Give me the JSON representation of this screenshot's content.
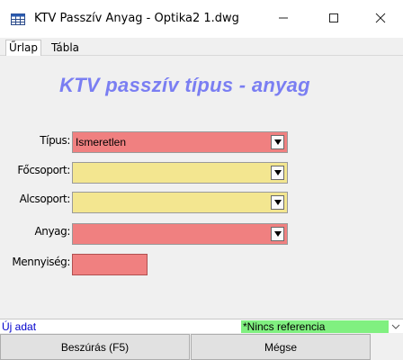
{
  "window": {
    "title": "KTV Passzív Anyag - Optika2 1.dwg",
    "icon": "table-window-icon",
    "controls": [
      "minimize-icon",
      "maximize-icon",
      "close-icon"
    ]
  },
  "tabs": [
    {
      "label": "Űrlap",
      "active": true
    },
    {
      "label": "Tábla",
      "active": false
    }
  ],
  "form": {
    "title": "KTV passzív típus - anyag",
    "fields": {
      "tipus": {
        "label": "Típus:",
        "value": "Ismeretlen",
        "color": "#f08080"
      },
      "focsoport": {
        "label": "Főcsoport:",
        "value": "",
        "color": "#f3e690"
      },
      "alcsoport": {
        "label": "Alcsoport:",
        "value": "",
        "color": "#f3e690"
      },
      "anyag": {
        "label": "Anyag:",
        "value": "",
        "color": "#f08080"
      },
      "mennyiseg": {
        "label": "Mennyiség:",
        "value": "",
        "color": "#f08080"
      }
    }
  },
  "status": {
    "left": "Új adat",
    "reference": "*Nincs referencia",
    "reference_color": "#80f080"
  },
  "buttons": {
    "insert": "Beszúrás (F5)",
    "cancel": "Mégse"
  },
  "colors": {
    "title_accent": "#7a7ef2",
    "required_red": "#f08080",
    "optional_yellow": "#f3e690",
    "status_link": "#0000cc"
  }
}
